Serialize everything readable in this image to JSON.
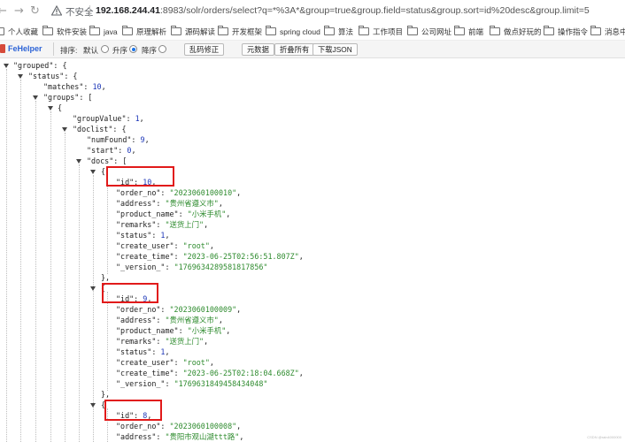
{
  "browser": {
    "insecure_label": "不安全",
    "url_host": "192.168.244.41",
    "url_rest": ":8983/solr/orders/select?q=*%3A*&group=true&group.field=status&group.sort=id%20desc&group.limit=5",
    "icons": [
      "back-arrow-icon",
      "forward-arrow-icon",
      "reload-icon",
      "warning-icon"
    ]
  },
  "bookmarks": [
    {
      "label": "个人收藏"
    },
    {
      "label": "软件安装"
    },
    {
      "label": "java"
    },
    {
      "label": "原理解析"
    },
    {
      "label": "源码解读"
    },
    {
      "label": "开发框架"
    },
    {
      "label": "spring cloud"
    },
    {
      "label": "算法"
    },
    {
      "label": "工作项目"
    },
    {
      "label": "公司网址"
    },
    {
      "label": "前端"
    },
    {
      "label": "做点好玩的"
    },
    {
      "label": "操作指令"
    },
    {
      "label": "消息中间"
    }
  ],
  "toolbar": {
    "brand": "FeHelper",
    "sort_label": "排序:",
    "sort_default": "默认",
    "sort_asc": "升序",
    "sort_desc": "降序",
    "sort_selected": "asc",
    "fix_button": "乱码修正",
    "raw_button": "元数据",
    "fold_button": "折叠所有",
    "download_button": "下载JSON"
  },
  "json_lines": [
    {
      "pre": "\"grouped\": {",
      "val": "",
      "post": ""
    },
    {
      "pre": "\"status\": {",
      "val": "",
      "post": ""
    },
    {
      "pre": "\"matches\": ",
      "val": "10",
      "post": ","
    },
    {
      "pre": "\"groups\": [",
      "val": "",
      "post": ""
    },
    {
      "pre": "{",
      "val": "",
      "post": ""
    },
    {
      "pre": "\"groupValue\": ",
      "val": "1",
      "post": ","
    },
    {
      "pre": "\"doclist\": {",
      "val": "",
      "post": ""
    },
    {
      "pre": "\"numFound\": ",
      "val": "9",
      "post": ","
    },
    {
      "pre": "\"start\": ",
      "val": "0",
      "post": ","
    },
    {
      "pre": "\"docs\": [",
      "val": "",
      "post": ""
    },
    {
      "pre": "{",
      "val": "",
      "post": ""
    },
    {
      "pre": "\"id\": ",
      "val": "10",
      "post": ","
    },
    {
      "pre": "\"order_no\": ",
      "val": "\"2023060100010\"",
      "post": ","
    },
    {
      "pre": "\"address\": ",
      "val": "\"贵州省遵义市\"",
      "post": ","
    },
    {
      "pre": "\"product_name\": ",
      "val": "\"小米手机\"",
      "post": ","
    },
    {
      "pre": "\"remarks\": ",
      "val": "\"送货上门\"",
      "post": ","
    },
    {
      "pre": "\"status\": ",
      "val": "1",
      "post": ","
    },
    {
      "pre": "\"create_user\": ",
      "val": "\"root\"",
      "post": ","
    },
    {
      "pre": "\"create_time\": ",
      "val": "\"2023-06-25T02:56:51.807Z\"",
      "post": ","
    },
    {
      "pre": "\"_version_\": ",
      "val": "\"1769634289581817856\"",
      "post": ""
    },
    {
      "pre": "},",
      "val": "",
      "post": ""
    },
    {
      "pre": "{",
      "val": "",
      "post": ""
    },
    {
      "pre": "\"id\": ",
      "val": "9",
      "post": ","
    },
    {
      "pre": "\"order_no\": ",
      "val": "\"2023060100009\"",
      "post": ","
    },
    {
      "pre": "\"address\": ",
      "val": "\"贵州省遵义市\"",
      "post": ","
    },
    {
      "pre": "\"product_name\": ",
      "val": "\"小米手机\"",
      "post": ","
    },
    {
      "pre": "\"remarks\": ",
      "val": "\"送货上门\"",
      "post": ","
    },
    {
      "pre": "\"status\": ",
      "val": "1",
      "post": ","
    },
    {
      "pre": "\"create_user\": ",
      "val": "\"root\"",
      "post": ","
    },
    {
      "pre": "\"create_time\": ",
      "val": "\"2023-06-25T02:18:04.668Z\"",
      "post": ","
    },
    {
      "pre": "\"_version_\": ",
      "val": "\"1769631849458434048\"",
      "post": ""
    },
    {
      "pre": "},",
      "val": "",
      "post": ""
    },
    {
      "pre": "{",
      "val": "",
      "post": ""
    },
    {
      "pre": "\"id\": ",
      "val": "8",
      "post": ","
    },
    {
      "pre": "\"order_no\": ",
      "val": "\"2023060100008\"",
      "post": ","
    },
    {
      "pre": "\"address\": ",
      "val": "\"贵阳市观山湖ttt路\"",
      "post": ","
    }
  ],
  "watermark": "CSDN @rain4000000"
}
